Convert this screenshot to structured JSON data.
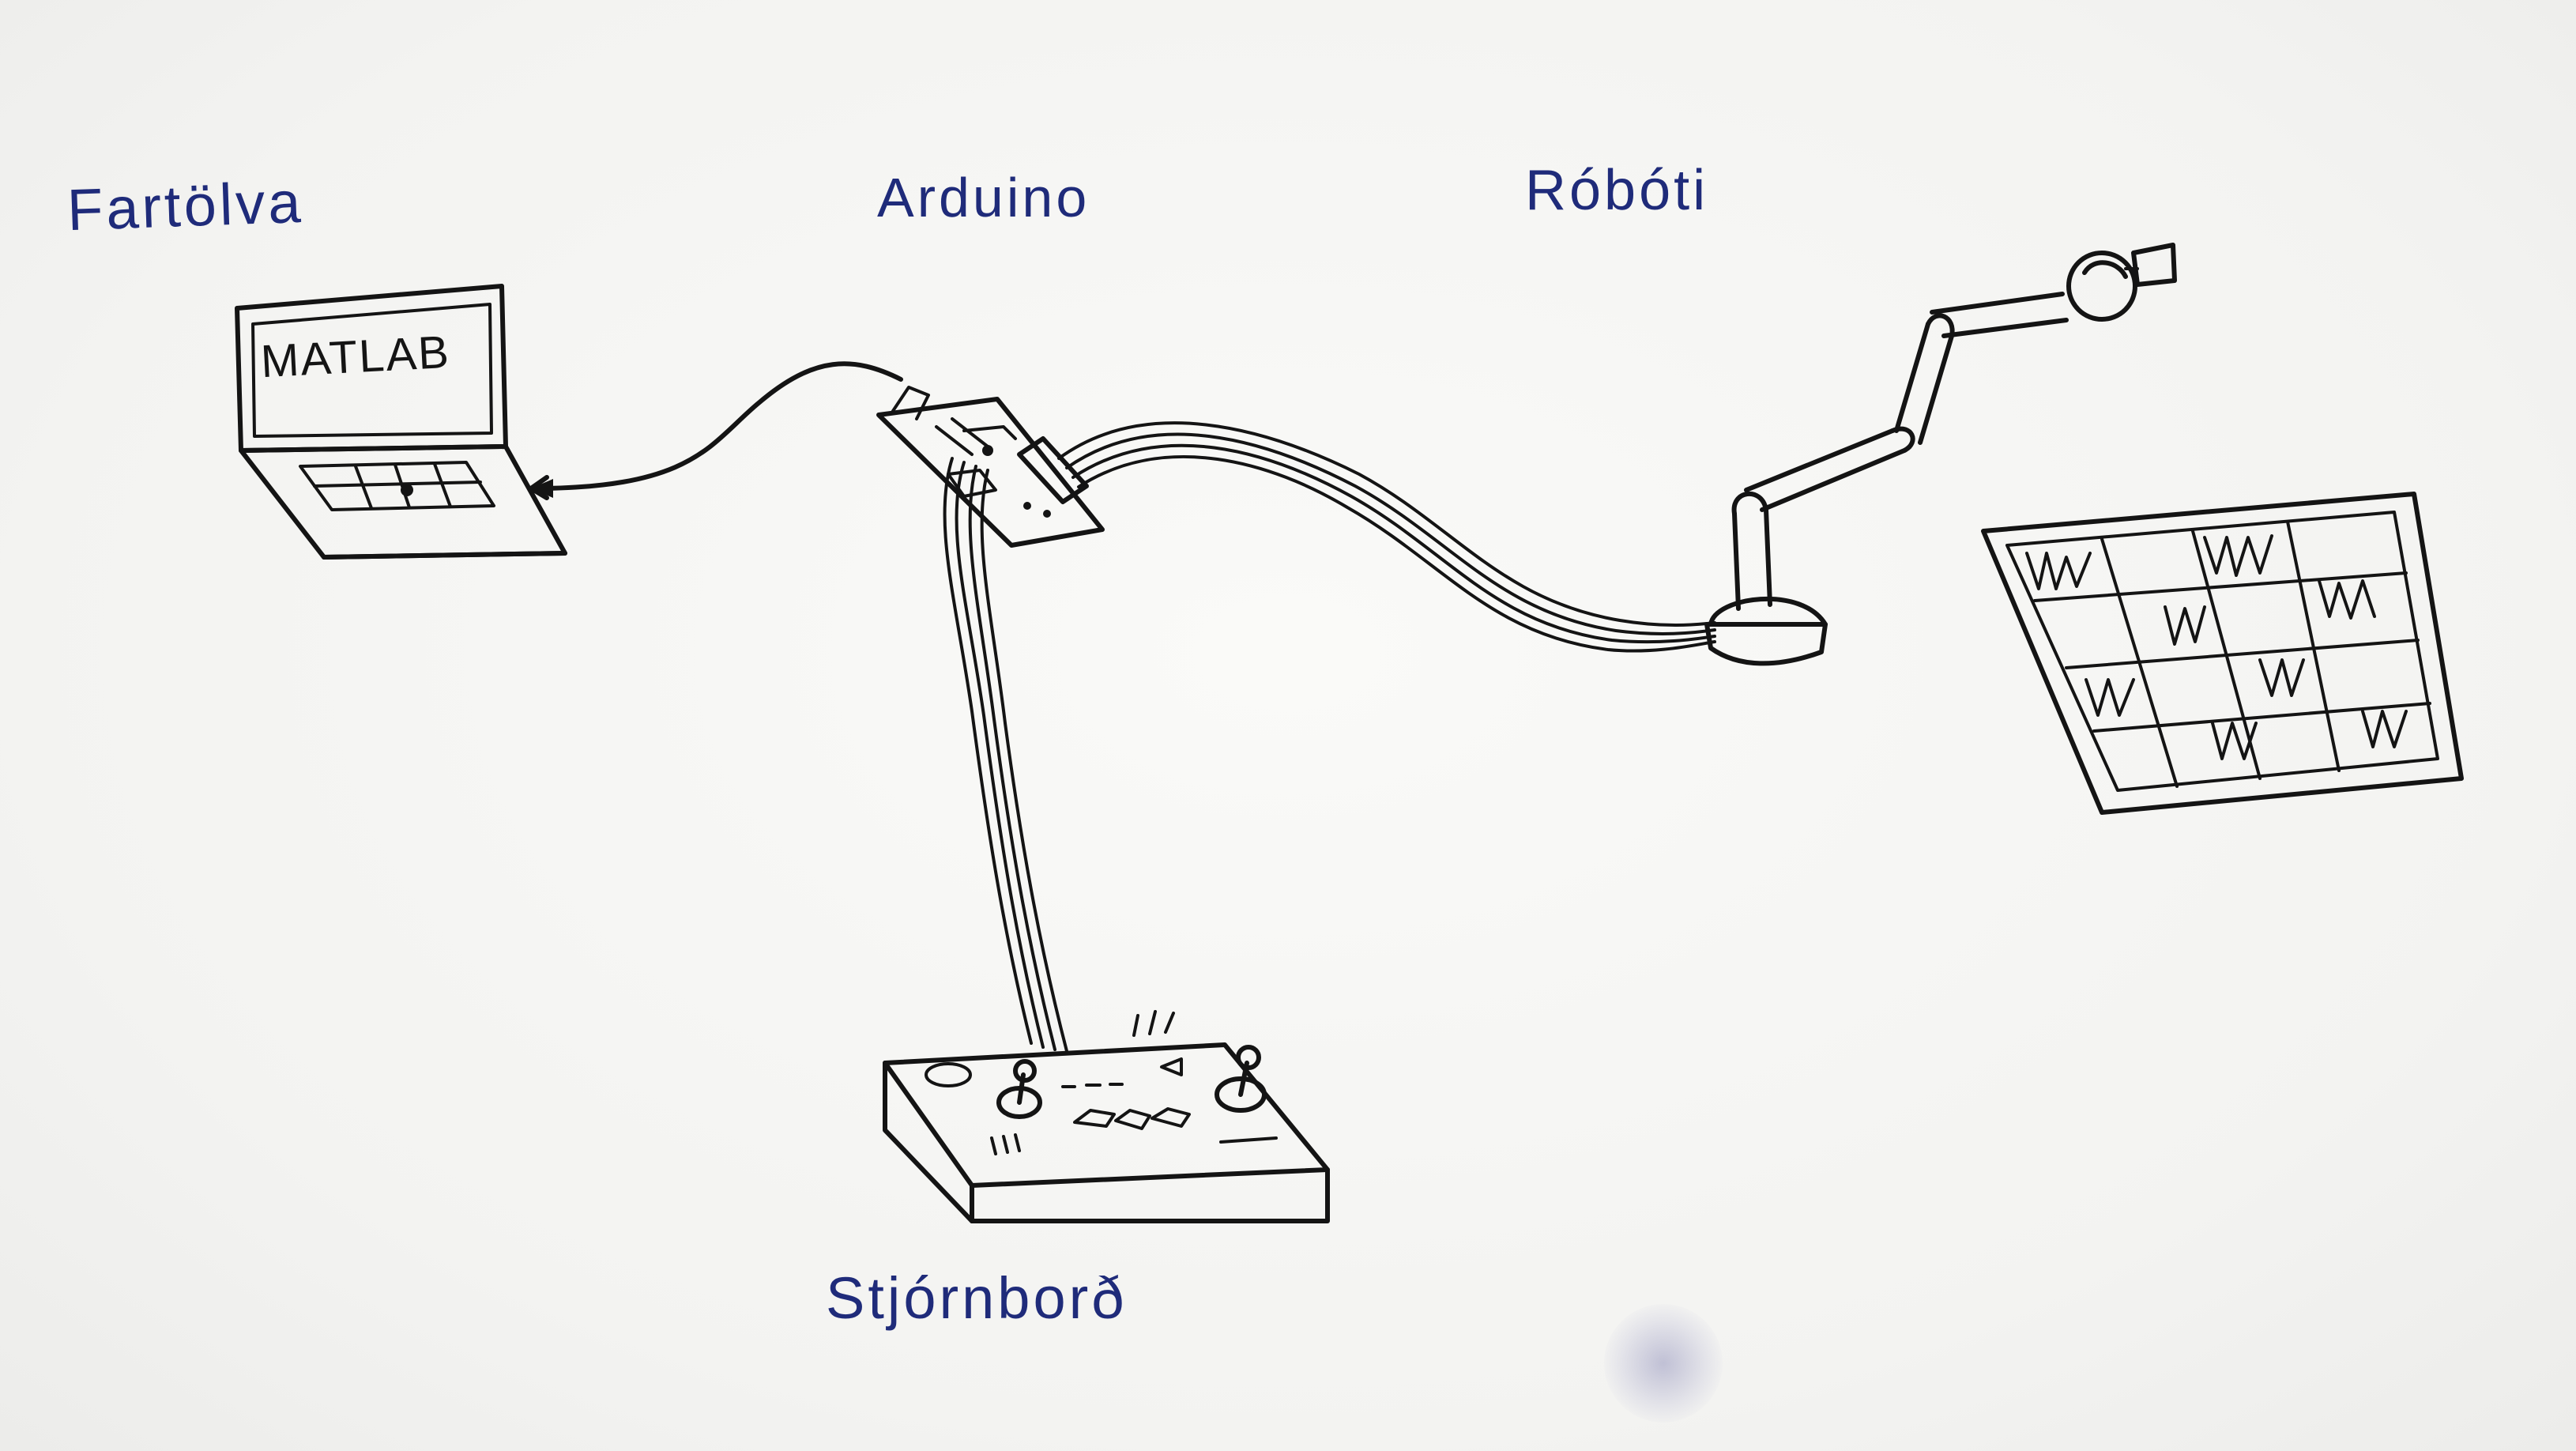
{
  "labels": {
    "laptop": "Fartölva",
    "arduino": "Arduino",
    "robot": "Róbóti",
    "control_board": "Stjórnborð"
  },
  "laptop_screen_text": "MATLAB",
  "colors": {
    "label_ink": "#1f2b7a",
    "drawing_ink": "#141414",
    "paper": "#f4f4f2"
  }
}
